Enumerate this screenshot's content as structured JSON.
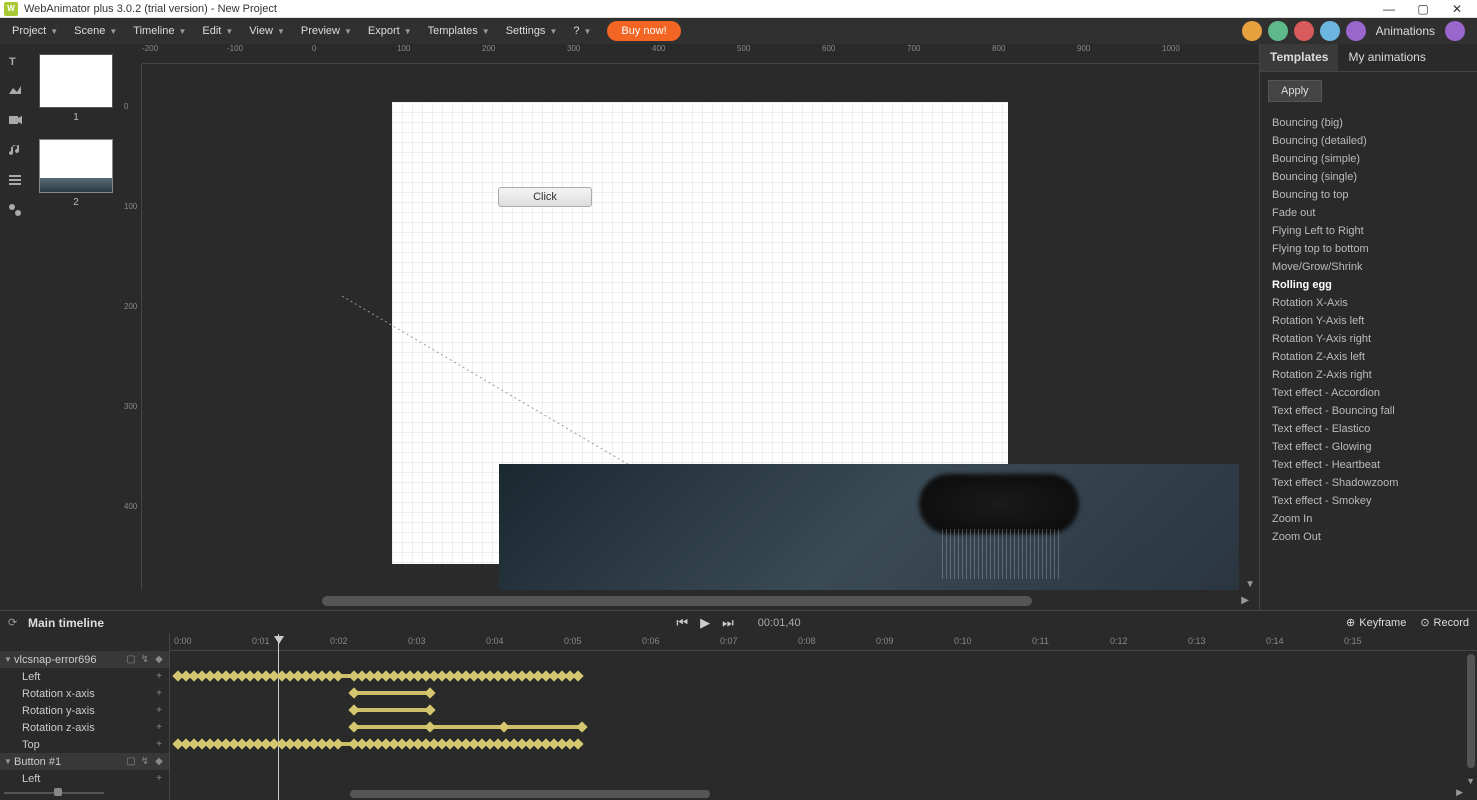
{
  "titlebar": {
    "icon_text": "W",
    "title": "WebAnimator plus 3.0.2 (trial version) - New Project"
  },
  "menus": [
    "Project",
    "Scene",
    "Timeline",
    "Edit",
    "View",
    "Preview",
    "Export",
    "Templates",
    "Settings",
    "?"
  ],
  "buy_label": "Buy now!",
  "animations_label": "Animations",
  "toolbar_colors": [
    "#e8a03e",
    "#5eb88a",
    "#d95a5a",
    "#6bb5e0",
    "#9966cc"
  ],
  "scenes": [
    {
      "num": "1",
      "active": false
    },
    {
      "num": "2",
      "active": true
    }
  ],
  "canvas": {
    "click_label": "Click"
  },
  "ruler_h": [
    "-200",
    "-100",
    "0",
    "100",
    "200",
    "300",
    "400",
    "500",
    "600",
    "700",
    "800",
    "900",
    "1000"
  ],
  "ruler_v": [
    "0",
    "100",
    "200",
    "300",
    "400"
  ],
  "panel": {
    "tabs": [
      "Templates",
      "My animations"
    ],
    "active_tab": 0,
    "apply_label": "Apply",
    "animations": [
      "Bouncing (big)",
      "Bouncing (detailed)",
      "Bouncing (simple)",
      "Bouncing (single)",
      "Bouncing to top",
      "Fade out",
      "Flying Left to Right",
      "Flying top to bottom",
      "Move/Grow/Shrink",
      "Rolling egg",
      "Rotation X-Axis",
      "Rotation Y-Axis left",
      "Rotation Y-Axis right",
      "Rotation Z-Axis left",
      "Rotation Z-Axis right",
      "Text effect - Accordion",
      "Text effect - Bouncing fall",
      "Text effect - Elastico",
      "Text effect - Glowing",
      "Text effect - Heartbeat",
      "Text effect - Shadowzoom",
      "Text effect - Smokey",
      "Zoom In",
      "Zoom Out"
    ],
    "selected_animation": 9
  },
  "timeline_header": {
    "title": "Main timeline",
    "time": "00:01,40",
    "keyframe_label": "Keyframe",
    "record_label": "Record"
  },
  "timeline_ruler": [
    "0:00",
    "0:01",
    "0:02",
    "0:03",
    "0:04",
    "0:05",
    "0:06",
    "0:07",
    "0:08",
    "0:09",
    "0:10",
    "0:11",
    "0:12",
    "0:13",
    "0:14",
    "0:15"
  ],
  "tracks": [
    {
      "name": "vlcsnap-error696",
      "group": true
    },
    {
      "name": "Left",
      "group": false
    },
    {
      "name": "Rotation x-axis",
      "group": false
    },
    {
      "name": "Rotation y-axis",
      "group": false
    },
    {
      "name": "Rotation z-axis",
      "group": false
    },
    {
      "name": "Top",
      "group": false
    },
    {
      "name": "Button #1",
      "group": true
    },
    {
      "name": "Left",
      "group": false
    }
  ]
}
